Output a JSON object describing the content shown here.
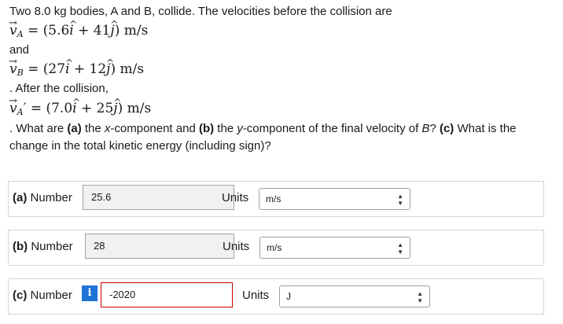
{
  "problem": {
    "intro": "Two 8.0 kg bodies, A and B, collide. The velocities before the collision are",
    "and": "and",
    "after": ". After the collision,",
    "question": ". What are (a) the x-component and (b) the y-component of the final velocity of B? (c) What is the",
    "question2": "change in the total kinetic energy (including sign)?",
    "vA": "(5.6î + 41ĵ) m/s",
    "vB": "(27î + 12ĵ) m/s",
    "vA_prime": "(7.0î + 25ĵ) m/s"
  },
  "answers": [
    {
      "letter": "(a)",
      "label": "Number",
      "value": "25.6",
      "units_label": "Units",
      "unit": "m/s"
    },
    {
      "letter": "(b)",
      "label": "Number",
      "value": "28",
      "units_label": "Units",
      "unit": "m/s"
    },
    {
      "letter": "(c)",
      "label": "Number",
      "value": "-2020",
      "units_label": "Units",
      "unit": "J",
      "info_icon": "i"
    }
  ]
}
